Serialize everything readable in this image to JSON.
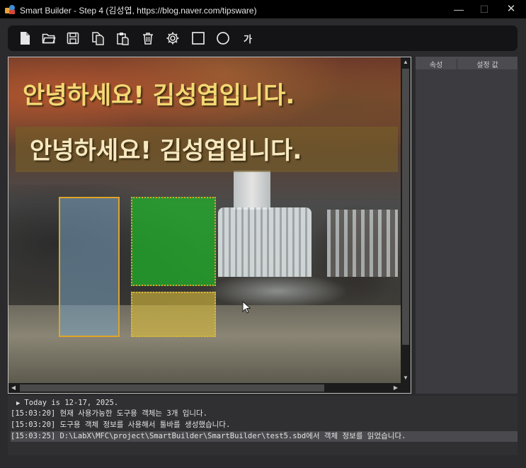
{
  "window": {
    "title": "Smart Builder - Step 4 (김성엽, https://blog.naver.com/tipsware)",
    "minimize": "—",
    "maximize": "☐",
    "close": "✕"
  },
  "toolbar": {
    "icons": [
      "new-file-icon",
      "open-folder-icon",
      "save-icon",
      "copy-icon",
      "paste-icon",
      "delete-icon",
      "settings-icon",
      "rectangle-icon",
      "ellipse-icon",
      "text-icon"
    ],
    "text_tool_label": "가"
  },
  "canvas": {
    "text_object_1": "안녕하세요! 김성엽입니다.",
    "text_object_2": "안녕하세요! 김성엽입니다.",
    "scroll_up": "▲",
    "scroll_down": "▼",
    "scroll_left": "◀",
    "scroll_right": "▶"
  },
  "properties": {
    "col_name": "속성",
    "col_value": "설정 값"
  },
  "log": {
    "lines": [
      "Today is 12-17, 2025.",
      "[15:03:20] 현재 사용가능한 도구용 객체는 3개 입니다.",
      "[15:03:20] 도구용 객체 정보를 사용해서 툴바를 생성했습니다.",
      "[15:03:25] D:\\LabX\\MFC\\project\\SmartBuilder\\SmartBuilder\\test5.sbd에서 객체 정보를 읽었습니다."
    ],
    "play_glyph": "▶"
  }
}
